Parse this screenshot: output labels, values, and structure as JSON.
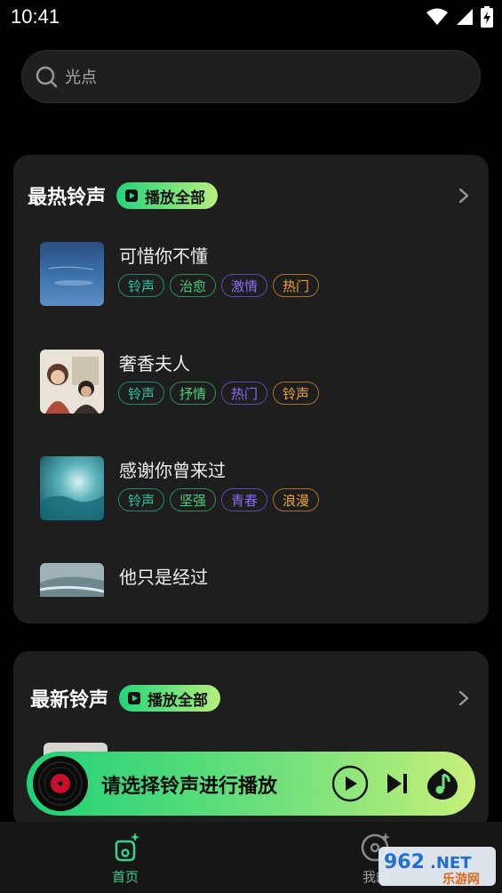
{
  "status_bar": {
    "time": "10:41"
  },
  "search": {
    "placeholder": "光点"
  },
  "hot_section": {
    "title": "最热铃声",
    "play_all_label": "播放全部",
    "songs": [
      {
        "title": "可惜你不懂",
        "tags": [
          "铃声",
          "治愈",
          "激情",
          "热门"
        ]
      },
      {
        "title": "奢香夫人",
        "tags": [
          "铃声",
          "抒情",
          "热门",
          "铃声"
        ]
      },
      {
        "title": "感谢你曾来过",
        "tags": [
          "铃声",
          "坚强",
          "青春",
          "浪漫"
        ]
      },
      {
        "title": "他只是经过",
        "tags": []
      }
    ]
  },
  "new_section": {
    "title": "最新铃声",
    "play_all_label": "播放全部"
  },
  "player": {
    "prompt": "请选择铃声进行播放"
  },
  "tab_bar": {
    "home_label": "首页",
    "mine_label": "我的"
  },
  "watermark": {
    "text": "962.NET",
    "subtext": "乐游网"
  },
  "colors": {
    "accent": "#22d57a",
    "tag_teal": "#27c3a3",
    "tag_green": "#4bd27c",
    "tag_purple": "#8c6cf5",
    "tag_orange": "#e9a23a"
  }
}
